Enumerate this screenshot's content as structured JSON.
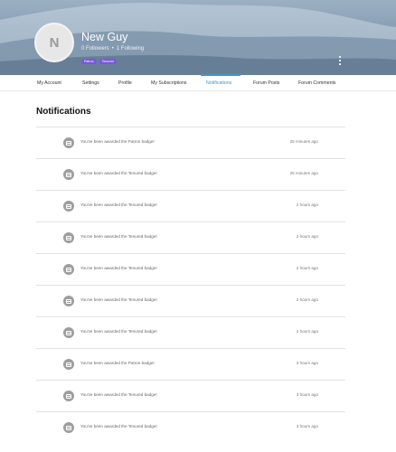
{
  "profile": {
    "avatar_initial": "N",
    "username": "New Guy",
    "followers": "0 Followers",
    "separator": "•",
    "following": "1 Following",
    "badges": [
      "Patron",
      "Tenured"
    ],
    "badge_color": "#7a56d8"
  },
  "tabs": [
    {
      "label": "My Account",
      "active": false
    },
    {
      "label": "Settings",
      "active": false
    },
    {
      "label": "Profile",
      "active": false
    },
    {
      "label": "My Subscriptions",
      "active": false
    },
    {
      "label": "Notifications",
      "active": true
    },
    {
      "label": "Forum Posts",
      "active": false
    },
    {
      "label": "Forum Comments",
      "active": false
    }
  ],
  "accent_color": "#4a90c7",
  "page_title": "Notifications",
  "notifications": [
    {
      "text": "You've been awarded the Patron badge!",
      "time": "25 minutes ago"
    },
    {
      "text": "You've been awarded the Tenured badge!",
      "time": "25 minutes ago"
    },
    {
      "text": "You've been awarded the Tenured badge!",
      "time": "2 hours ago"
    },
    {
      "text": "You've been awarded the Tenured badge!",
      "time": "2 hours ago"
    },
    {
      "text": "You've been awarded the Tenured badge!",
      "time": "2 hours ago"
    },
    {
      "text": "You've been awarded the Tenured badge!",
      "time": "2 hours ago"
    },
    {
      "text": "You've been awarded the Tenured badge!",
      "time": "2 hours ago"
    },
    {
      "text": "You've been awarded the Patron badge!",
      "time": "3 hours ago"
    },
    {
      "text": "You've been awarded the Tenured badge!",
      "time": "3 hours ago"
    },
    {
      "text": "You've been awarded the Tenured badge!",
      "time": "3 hours ago"
    }
  ]
}
